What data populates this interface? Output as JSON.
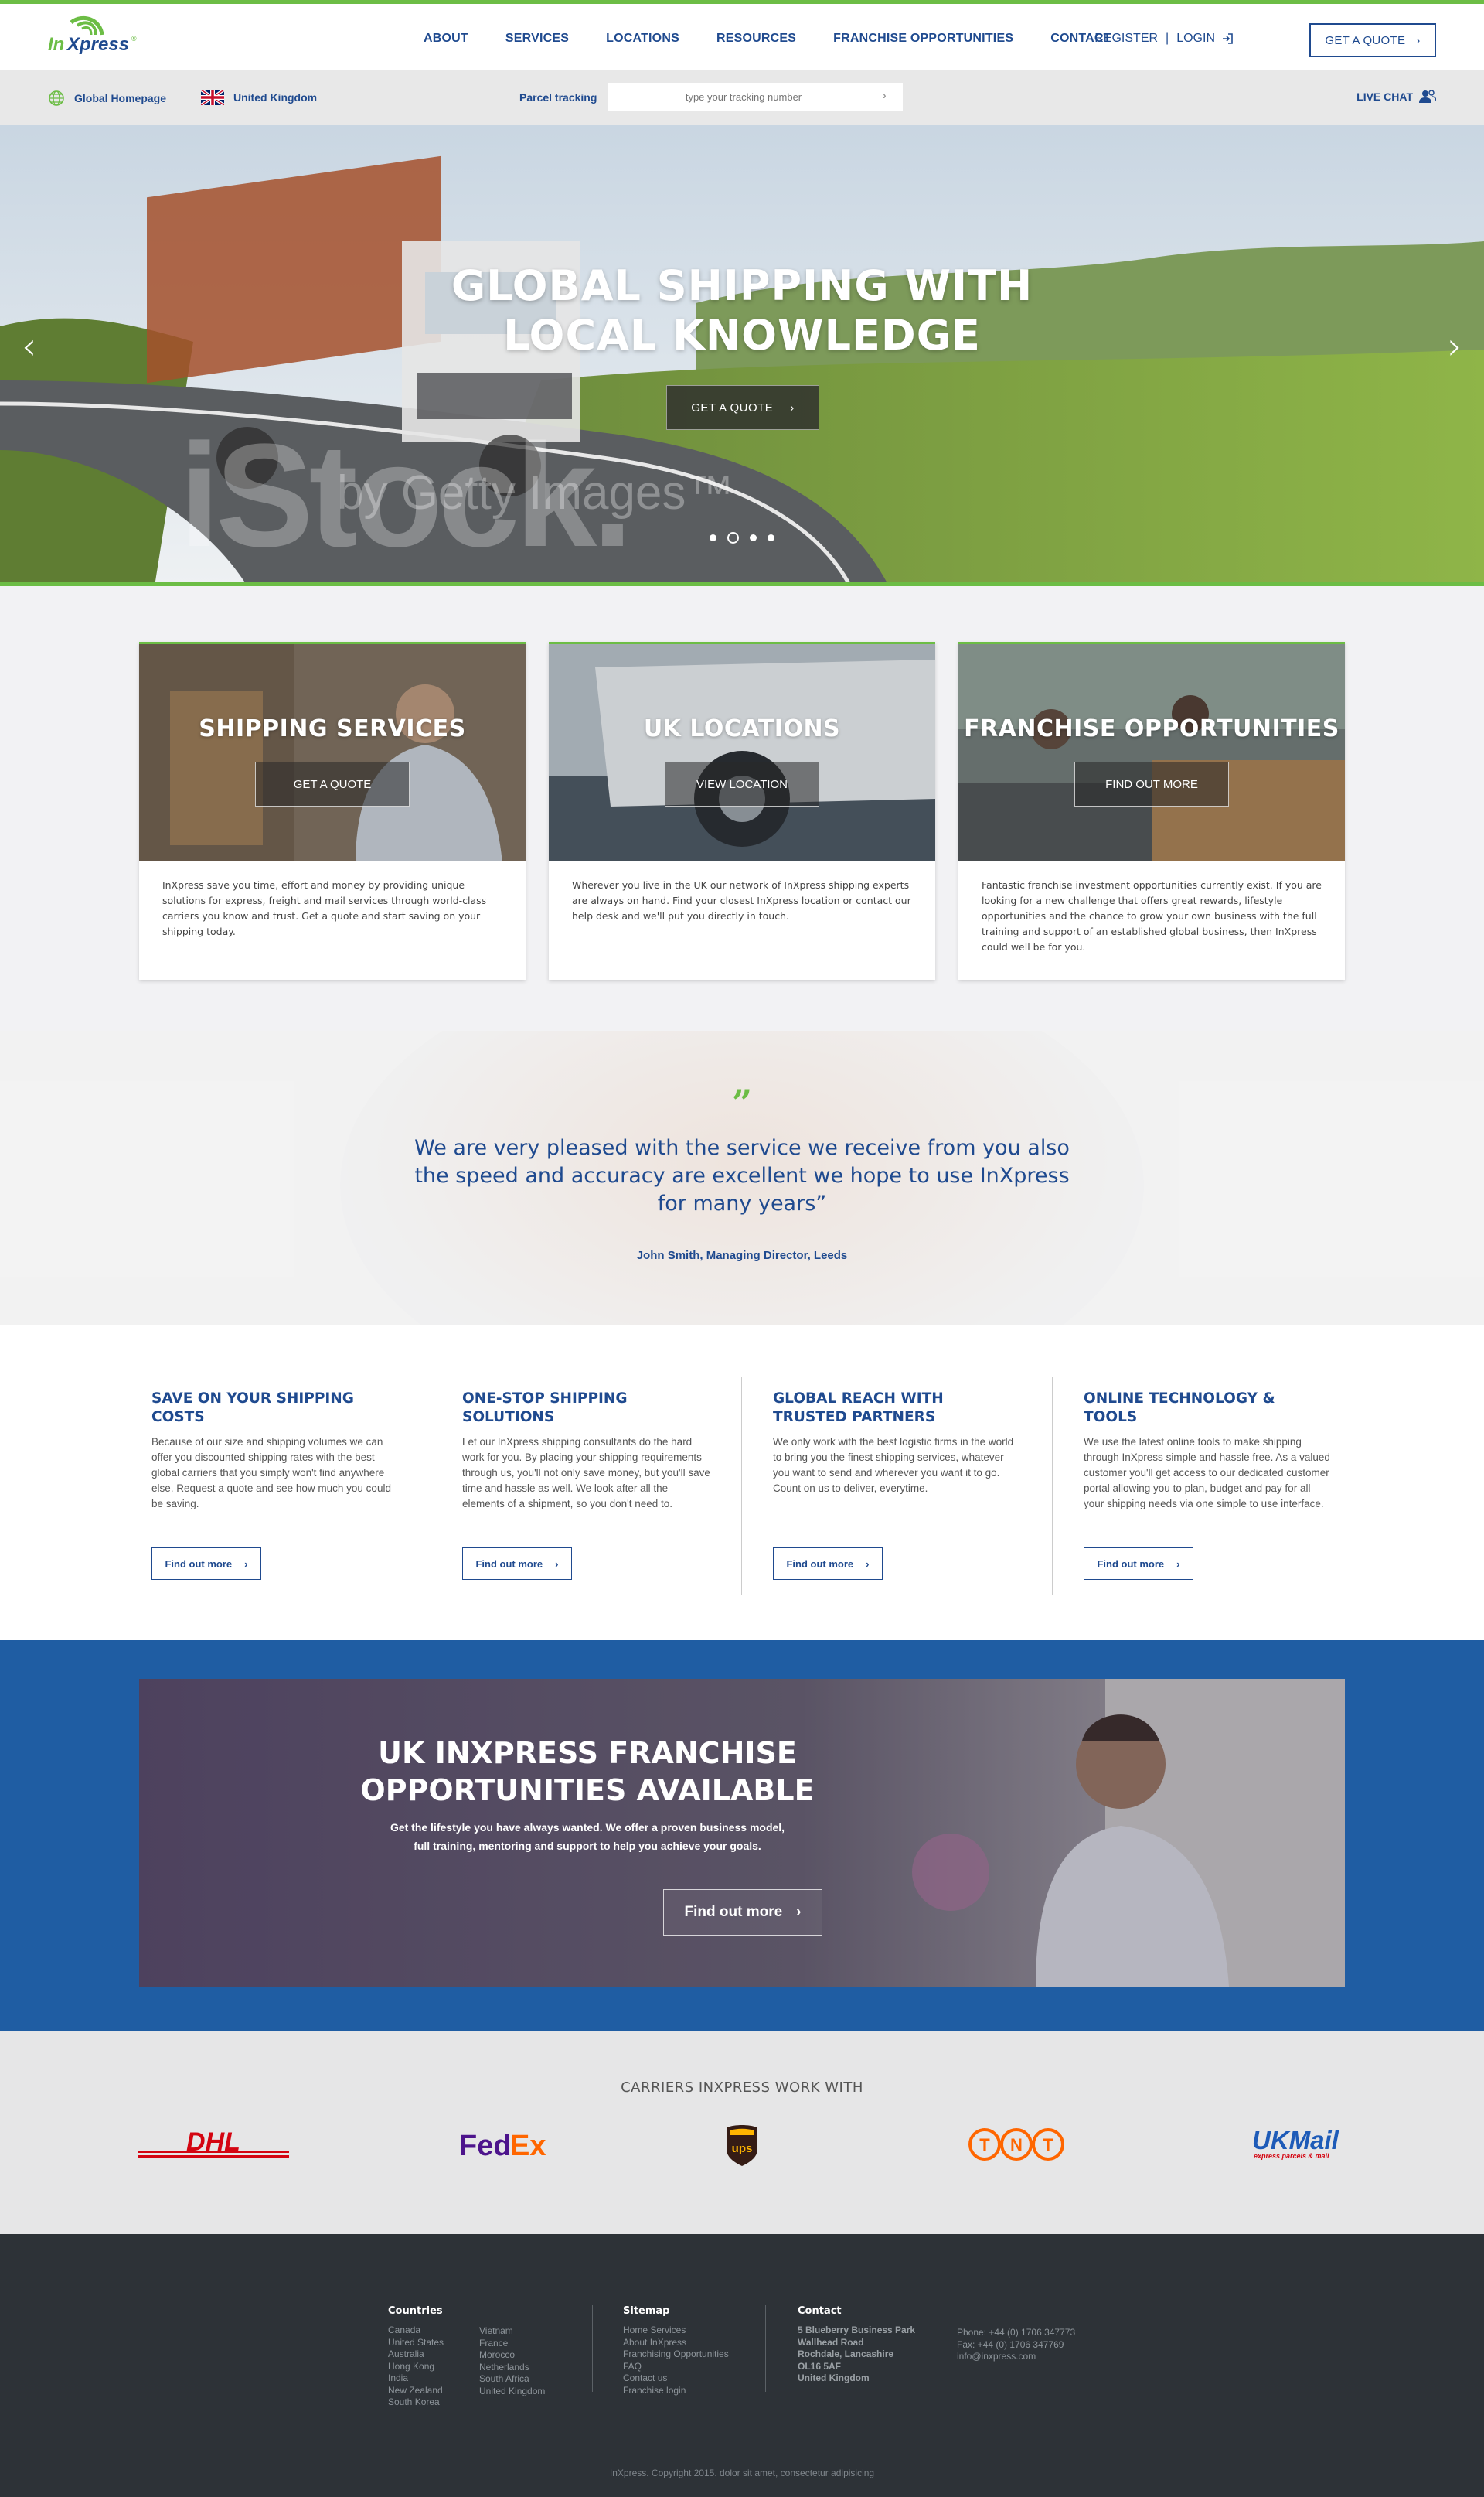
{
  "header": {
    "logo_text": "InXpress",
    "nav": [
      "ABOUT",
      "SERVICES",
      "LOCATIONS",
      "RESOURCES",
      "FRANCHISE OPPORTUNITIES",
      "CONTACT"
    ],
    "register": "REGISTER",
    "separator": "|",
    "login": "LOGIN",
    "quote_button": "GET A QUOTE"
  },
  "subbar": {
    "global_homepage": "Global Homepage",
    "country": "United Kingdom",
    "tracking_label": "Parcel tracking",
    "tracking_placeholder": "type your tracking number",
    "live_chat": "LIVE CHAT"
  },
  "hero": {
    "title_line1": "GLOBAL SHIPPING WITH",
    "title_line2": "LOCAL KNOWLEDGE",
    "button": "GET A QUOTE",
    "slide_count": 4,
    "active_slide": 2,
    "watermark_main": "iStock.",
    "watermark_sub": "by Getty Images™"
  },
  "cards": [
    {
      "title": "SHIPPING SERVICES",
      "button": "GET A QUOTE",
      "text": "InXpress save you time, effort and money by providing unique solutions for express, freight and mail services through world-class carriers you know and trust. Get a quote and start saving on your shipping today."
    },
    {
      "title": "UK LOCATIONS",
      "button": "VIEW LOCATION",
      "text": "Wherever you live in the UK our network of InXpress shipping experts are always on hand. Find your closest InXpress location or contact our help desk and we'll put you directly in touch."
    },
    {
      "title": "FRANCHISE OPPORTUNITIES",
      "button": "FIND OUT MORE",
      "text": "Fantastic franchise investment opportunities currently exist. If you are looking for a new challenge that offers great rewards, lifestyle opportunities and the chance to grow your own business with the full training and support of an established global business, then InXpress could well be for you."
    }
  ],
  "testimonial": {
    "mark": "”",
    "line1": "We are very pleased with the service we receive from you also",
    "line2": "the speed and accuracy are excellent we hope to use InXpress",
    "line3": "for many years”",
    "author": "John Smith, Managing Director,  Leeds"
  },
  "features": [
    {
      "title": "SAVE ON YOUR SHIPPING COSTS",
      "text": "Because of our size and shipping volumes we can offer you discounted shipping rates with the best global carriers that you simply won't find anywhere else. Request a quote and see how much you could be saving.",
      "button": "Find out more"
    },
    {
      "title": "ONE-STOP SHIPPING SOLUTIONS",
      "text": "Let our InXpress shipping consultants do the hard work for you. By placing your shipping requirements through us, you'll not only save money, but you'll save time and hassle as well. We look after all the elements of a shipment, so you don't need to.",
      "button": "Find out more"
    },
    {
      "title": "GLOBAL REACH WITH TRUSTED PARTNERS",
      "text": "We only work with the best logistic firms in the world to bring you the finest shipping services, whatever you want to send and wherever you want it to go. Count on us to deliver, everytime.",
      "button": "Find out more"
    },
    {
      "title": "ONLINE TECHNOLOGY & TOOLS",
      "text": "We use the latest online tools to make shipping through InXpress simple and hassle free. As a valued customer you'll get access to our dedicated customer portal allowing you to plan, budget and pay for all your shipping needs via one simple to use interface.",
      "button": "Find out more"
    }
  ],
  "franchise": {
    "title_line1": "UK INXPRESS FRANCHISE",
    "title_line2": "OPPORTUNITIES AVAILABLE",
    "text_line1": "Get the lifestyle you have always wanted. We offer a proven business model,",
    "text_line2": "full training, mentoring and support to help you achieve your goals.",
    "button": "Find out more"
  },
  "carriers": {
    "heading": "CARRIERS INXPRESS WORK WITH",
    "dhl": "DHL",
    "fedex_fed": "Fed",
    "fedex_ex": "Ex",
    "ups": "ups",
    "tnt": [
      "T",
      "N",
      "T"
    ],
    "ukmail": "UKMail",
    "ukmail_tag": "express parcels & mail"
  },
  "footer": {
    "countries_heading": "Countries",
    "countries_col1": [
      "Canada",
      "United States",
      "Australia",
      "Hong Kong",
      "India",
      "New Zealand",
      "South Korea"
    ],
    "countries_col2": [
      "Vietnam",
      "France",
      "Morocco",
      "Netherlands",
      "South Africa",
      "United Kingdom"
    ],
    "sitemap_heading": "Sitemap",
    "sitemap": [
      "Home Services",
      "About InXpress",
      "Franchising Opportunities",
      "FAQ",
      "Contact us",
      "Franchise login"
    ],
    "contact_heading": "Contact",
    "address": [
      "5 Blueberry Business Park",
      "Wallhead Road",
      "Rochdale, Lancashire",
      "OL16 5AF",
      "United Kingdom"
    ],
    "phone": "Phone: +44 (0) 1706 347773",
    "fax": "Fax: +44 (0) 1706 347769",
    "email": "info@inxpress.com",
    "copyright": "InXpress. Copyright 2015. dolor sit amet, consectetur adipisicing"
  },
  "colors": {
    "brand_blue": "#1f4a8f",
    "brand_green": "#6cbd45",
    "franchise_blue": "#1f5da3",
    "footer": "#2d3237"
  }
}
